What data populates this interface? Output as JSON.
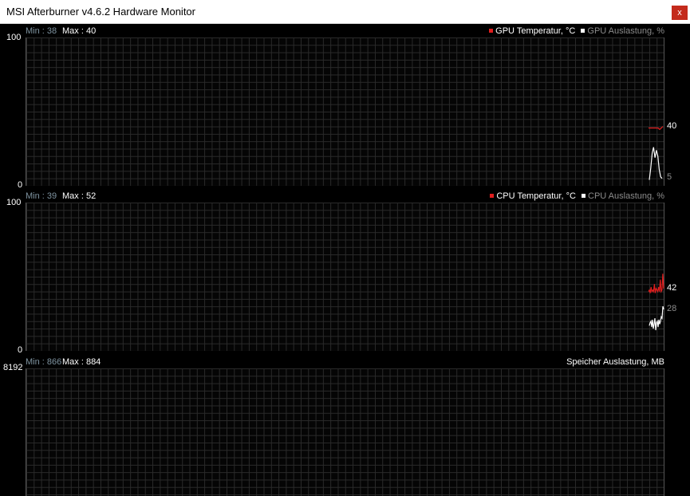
{
  "window": {
    "title": "MSI Afterburner v4.6.2 Hardware Monitor",
    "close_glyph": "x"
  },
  "graphs": [
    {
      "min_text": "Min : 38",
      "max_text": "Max : 40",
      "y_top": "100",
      "y_bottom": "0",
      "legend_primary": "GPU Temperatur, °C",
      "legend_secondary": "GPU Auslastung, %",
      "current_primary": "40",
      "current_secondary": "5",
      "primary_color": "#e01e1e",
      "secondary_color": "#ffffff"
    },
    {
      "min_text": "Min : 39",
      "max_text": "Max : 52",
      "y_top": "100",
      "y_bottom": "0",
      "legend_primary": "CPU Temperatur, °C",
      "legend_secondary": "CPU Auslastung, %",
      "current_primary": "42",
      "current_secondary": "28",
      "primary_color": "#e01e1e",
      "secondary_color": "#ffffff"
    },
    {
      "min_text": "Min : 866",
      "max_text": "Max : 884",
      "y_top": "8192",
      "legend_title": "Speicher Auslastung, MB"
    }
  ],
  "chart_data": [
    {
      "type": "line",
      "ylim": [
        0,
        100
      ],
      "series": [
        {
          "name": "GPU Temperatur, °C",
          "values": [
            39,
            39,
            39,
            39,
            39,
            39,
            39,
            38,
            39,
            40
          ]
        },
        {
          "name": "GPU Auslastung, %",
          "values": [
            4,
            12,
            22,
            26,
            19,
            24,
            20,
            11,
            6,
            5
          ]
        }
      ]
    },
    {
      "type": "line",
      "ylim": [
        0,
        100
      ],
      "series": [
        {
          "name": "CPU Temperatur, °C",
          "values": [
            40,
            41,
            39,
            43,
            40,
            41,
            40,
            45,
            39,
            42,
            41,
            40,
            43,
            40,
            48,
            40,
            41,
            52,
            42
          ]
        },
        {
          "name": "CPU Auslastung, %",
          "values": [
            17,
            19,
            20,
            16,
            21,
            15,
            18,
            22,
            14,
            19,
            20,
            16,
            21,
            18,
            20,
            23,
            22,
            30,
            28
          ]
        }
      ]
    },
    {
      "type": "line",
      "ylim": [
        0,
        8192
      ],
      "series": [
        {
          "name": "Speicher Auslastung, MB",
          "values": []
        }
      ]
    }
  ]
}
